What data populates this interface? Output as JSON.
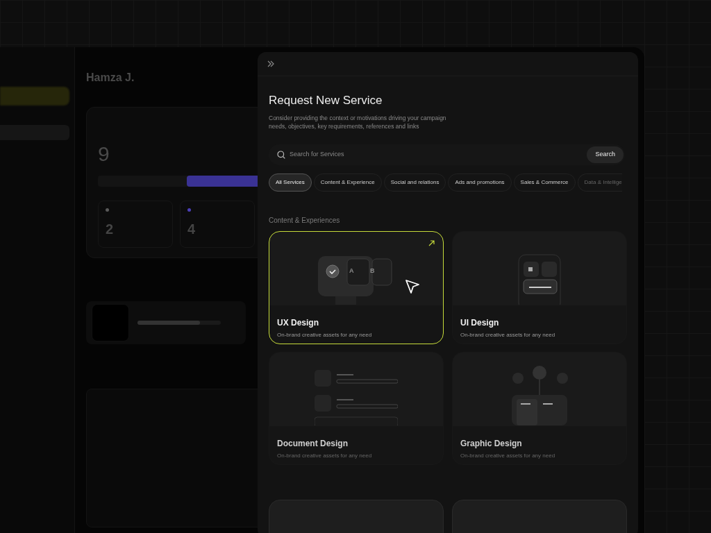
{
  "dashboard": {
    "user_name": "Hamza J.",
    "sprint_total": "9",
    "project": {
      "level": 0.75
    },
    "stats": [
      {
        "value": "2",
        "color": "#5a5a5a"
      },
      {
        "value": "4",
        "color": "#4b3fb8"
      }
    ]
  },
  "panel": {
    "title": "Request New Service",
    "description": "Consider providing the context or motivations driving your campaign needs, objectives, key requirements, references and links",
    "search": {
      "placeholder": "Search for Services",
      "button": "Search"
    },
    "filters": [
      {
        "label": "All Services",
        "selected": true
      },
      {
        "label": "Content & Experience",
        "selected": false
      },
      {
        "label": "Social and relations",
        "selected": false
      },
      {
        "label": "Ads and promotions",
        "selected": false
      },
      {
        "label": "Sales & Commerce",
        "selected": false
      },
      {
        "label": "Data & Intellige",
        "selected": false
      }
    ],
    "section_title": "Content & Experiences",
    "cards": [
      {
        "kind": "ux",
        "variants": [
          "A",
          "B"
        ],
        "title": "UX Design",
        "subtitle": "On-brand creative assets for any need",
        "selected": true
      },
      {
        "kind": "ui",
        "title": "UI Design",
        "subtitle": "On-brand creative assets for any need",
        "selected": false
      },
      {
        "kind": "document",
        "title": "Document Design",
        "subtitle": "On-brand creative assets for any need",
        "selected": false
      },
      {
        "kind": "graphic",
        "title": "Graphic Design",
        "subtitle": "On-brand creative assets for any need",
        "selected": false
      }
    ]
  }
}
